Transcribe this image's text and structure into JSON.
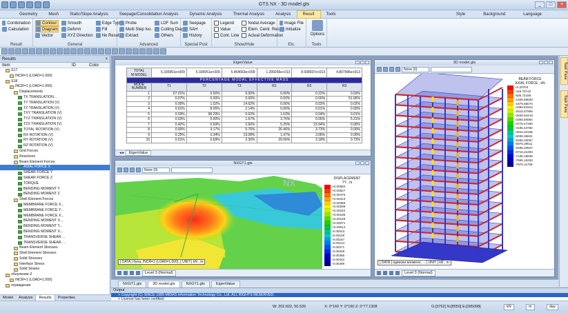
{
  "app": {
    "title": "GTS NX - 3D model.gts"
  },
  "window_controls": [
    "_",
    "□",
    "×"
  ],
  "menu": {
    "items": [
      "Geometry",
      "Mesh",
      "Static/Slope Analysis",
      "Seepage/Consolidation Analysis",
      "Dynamic Analysis",
      "Thermal Analysis",
      "Analysis",
      "Result",
      "Tools"
    ],
    "right": [
      "Style",
      "Background",
      "Language"
    ]
  },
  "ribbon": {
    "result": {
      "label": "Result",
      "items": [
        "Combination",
        "Calculation"
      ]
    },
    "general": {
      "label": "General",
      "col1": [
        "Contour",
        "Diagram",
        "Vector"
      ],
      "col2": [
        "Smooth",
        "Deform",
        "XYZ Direction"
      ],
      "col3": [
        "Edge Type",
        "Fill",
        "No Results"
      ]
    },
    "advanced": {
      "label": "Advanced",
      "col1": [
        "Probe",
        "Multi Step Iso.",
        "Extract"
      ],
      "col2": [
        "LDF Sum",
        "Cutting Diag.",
        "Others"
      ]
    },
    "special_post": {
      "label": "Special Post",
      "items": [
        "Seepage",
        "SAH",
        "History"
      ]
    },
    "show_hide": {
      "label": "Show/Hide",
      "col1": [
        "Legend",
        "Value",
        "Cont. Line"
      ],
      "col2": [
        "Nodal Average",
        "Elem. Centr. Result",
        "Actual Deformation"
      ]
    },
    "etc": {
      "label": "Etc.",
      "items": [
        "Image File",
        "Initialize"
      ]
    },
    "tools": {
      "label": "Tools",
      "items": [
        "Options"
      ]
    }
  },
  "results_panel": {
    "title": "Results",
    "columns": [
      "Item",
      "ID",
      "Color"
    ],
    "tree": [
      {
        "t": "S17",
        "lvl": 1,
        "icon": "y"
      },
      {
        "t": "INCR=1 (LOAD=1.000)",
        "lvl": 2,
        "icon": "y"
      },
      {
        "t": "S18",
        "lvl": 1,
        "icon": "y"
      },
      {
        "t": "INCR=1 (LOAD=1.000)",
        "lvl": 2,
        "icon": "y"
      },
      {
        "t": "Displacements",
        "lvl": 3,
        "icon": "y"
      },
      {
        "t": "TX TRANSLATION...",
        "lvl": 4,
        "icon": "g"
      },
      {
        "t": "TY TRANSLATION (V)",
        "lvl": 4,
        "icon": "g"
      },
      {
        "t": "TZ TRANSLATION (V)",
        "lvl": 4,
        "icon": "g"
      },
      {
        "t": "TXY TRANSLATION (V)",
        "lvl": 4,
        "icon": "g"
      },
      {
        "t": "TYZ TRANSLATION (V)",
        "lvl": 4,
        "icon": "g"
      },
      {
        "t": "TZX TRANSLATION (V)",
        "lvl": 4,
        "icon": "g"
      },
      {
        "t": "TOTAL ROTATION (V)",
        "lvl": 4,
        "icon": "g"
      },
      {
        "t": "RX ROTATION (V)",
        "lvl": 4,
        "icon": "g"
      },
      {
        "t": "RY ROTATION (V)",
        "lvl": 4,
        "icon": "g"
      },
      {
        "t": "RZ ROTATION (V)",
        "lvl": 4,
        "icon": "g"
      },
      {
        "t": "Grid Forces",
        "lvl": 3,
        "icon": "y"
      },
      {
        "t": "Reactions",
        "lvl": 3,
        "icon": "y"
      },
      {
        "t": "Beam Element Forces",
        "lvl": 3,
        "icon": "y"
      },
      {
        "t": "AXIAL FORCE X",
        "lvl": 4,
        "icon": "g",
        "hl": true
      },
      {
        "t": "SHEAR FORCE Y",
        "lvl": 4,
        "icon": "g"
      },
      {
        "t": "SHEAR FORCE Z",
        "lvl": 4,
        "icon": "g"
      },
      {
        "t": "TORQUE",
        "lvl": 4,
        "icon": "g"
      },
      {
        "t": "BENDING MOMENT Y",
        "lvl": 4,
        "icon": "g"
      },
      {
        "t": "BENDING MOMENT Z",
        "lvl": 4,
        "icon": "g"
      },
      {
        "t": "Shell Element Forces",
        "lvl": 3,
        "icon": "y"
      },
      {
        "t": "MEMBRANE FORCE X...",
        "lvl": 4,
        "icon": "g"
      },
      {
        "t": "MEMBRANE FORCE Y...",
        "lvl": 4,
        "icon": "g"
      },
      {
        "t": "MEMBRANE FORCE X...",
        "lvl": 4,
        "icon": "g"
      },
      {
        "t": "BENDING MOMENT X...",
        "lvl": 4,
        "icon": "g"
      },
      {
        "t": "BENDING MOMENT Y...",
        "lvl": 4,
        "icon": "g"
      },
      {
        "t": "BENDING MOMENT X...",
        "lvl": 4,
        "icon": "g"
      },
      {
        "t": "TRANSVERSE SHEAR ...",
        "lvl": 4,
        "icon": "g"
      },
      {
        "t": "TRANSVERSE SHEAR ...",
        "lvl": 4,
        "icon": "g"
      },
      {
        "t": "Beam Element Stresses",
        "lvl": 3,
        "icon": "y"
      },
      {
        "t": "Shell Element Stresses",
        "lvl": 3,
        "icon": "y"
      },
      {
        "t": "Solid Stresses",
        "lvl": 3,
        "icon": "y"
      },
      {
        "t": "Interface Stress",
        "lvl": 3,
        "icon": "y"
      },
      {
        "t": "Solid Strains",
        "lvl": 3,
        "icon": "y"
      },
      {
        "t": "обнуление-2",
        "lvl": 1,
        "icon": "y"
      },
      {
        "t": "INCR=1 (LOAD=1.000)",
        "lvl": 2,
        "icon": "y"
      },
      {
        "t": "ограждение",
        "lvl": 1,
        "icon": "y"
      }
    ],
    "tabs": [
      "Model",
      "Analysis",
      "Results",
      "Properties"
    ]
  },
  "eigen_window": {
    "title": "EigenValue",
    "total_row": {
      "label": "TOTAL\nM MODEL",
      "values": [
        "5.335951e+009",
        "5.335951e+009",
        "5.464663e+009",
        "1.299266e+013",
        "8.938937e+013",
        "4.807996e+013"
      ]
    },
    "band": "PERCENTAGE MODAL EFFECTIVE MASS",
    "headers": [
      "MODE\nNUMBER",
      "T1",
      "T2",
      "T3",
      "R1",
      "R2",
      "R3"
    ],
    "rows": [
      [
        "1",
        "67.01%",
        "0.00%",
        "0.00%",
        "0.00%",
        "0.22%",
        "0.03%"
      ],
      [
        "2",
        "0.07%",
        "0.00%",
        "0.00%",
        "0.00%",
        "0.00%",
        "51.96%"
      ],
      [
        "3",
        "0.00%",
        "1.02%",
        "14.62%",
        "0.06%",
        "0.02%",
        "0.02%"
      ],
      [
        "4",
        "0.01%",
        "8.05%",
        "2.14%",
        "0.00%",
        "0.01%",
        "0.00%"
      ],
      [
        "5",
        "0.03%",
        "96.29%",
        "0.62%",
        "1.63%",
        "0.04%",
        "0.01%"
      ],
      [
        "6",
        "0.03%",
        "0.00%",
        "1.67%",
        "3.76%",
        "0.05%",
        "5.31%"
      ],
      [
        "7",
        "0.42%",
        "0.69%",
        "2.60%",
        "5.25%",
        "23.94%",
        "0.00%"
      ],
      [
        "8",
        "0.00%",
        "3.17%",
        "5.76%",
        "26.46%",
        "3.73%",
        "0.00%"
      ],
      [
        "9",
        "0.25%",
        "0.34%",
        "19.08%",
        "1.97%",
        "3.06%",
        "0.00%"
      ],
      [
        "10",
        "0.01%",
        "0.69%",
        "2.30%",
        "29.06%",
        "3.18%",
        "0.73%"
      ]
    ],
    "tab": "EigenValue"
  },
  "nxgt_window": {
    "title": "NXGT1.gts",
    "dropdown": "None (0)",
    "legend_title": "DISPLACEMENT\nTY , m",
    "legend": [
      "+0.00584",
      "+0.00527",
      "+0.00470",
      "+0.00413",
      "+0.00356",
      "+0.00299",
      "+0.00242",
      "+0.00185",
      "+0.00128",
      "+0.00071",
      "+0.00014",
      "-0.00043",
      "-0.00100",
      "-0.00157",
      "-0.00214",
      "-0.00271",
      "-0.00328",
      "-0.00385",
      "-0.00442",
      "-0.00499"
    ],
    "info": "[ DATA ] буна, INCR=1 (LOAD=1.000), [ UNIT ] kN , m",
    "level": "Level 3 (Normal)"
  },
  "model3d_window": {
    "title": "3D model.gts",
    "dropdown": "None (0)",
    "legend_title": "BEAM FORCE\nAXIAL FORCE , kN",
    "legend": [
      "+4.20702",
      "-415.75742",
      "-835.72186",
      "-1255.68630",
      "-1675.65074",
      "-2095.61523",
      "-2515.57969",
      "-2935.54419",
      "-3355.50864",
      "-3775.47290",
      "-4195.43750",
      "-4615.40195",
      "-5035.36621",
      "-5455.33057",
      "-5875.29511",
      "-6295.25947",
      "-6715.22393",
      "-7135.18848",
      "-7555.15293",
      "-7975.11759"
    ],
    "info": "[ DATA ] одиноки вложено, ... [ UNIT ] kN , m",
    "level": "Level 3 (Normal)"
  },
  "document_tabs": [
    "NXGT1.gts",
    "3D model.gts",
    "NXGT1.gts",
    "EigenValue"
  ],
  "right_strip": [
    "Task Pane",
    "Task Pane"
  ],
  "output": {
    "title": "Output",
    "lines": [
      "> Copyright (C) SINCE 1989 MIDAS Information Technology Co., Ltd. ALL RIGHTS RESERVED.",
      "> License has been certified."
    ]
  },
  "status": {
    "coords": "W: 202.602, 50.539",
    "angle": "X: 0°160 Y: 0°160 Z: 0°77.1308",
    "node": "G:[3762] N:[8550] E:[285098]",
    "unit_force": "kN",
    "unit_len": "m",
    "unit_time": "day"
  },
  "colors": {
    "accent": "#3d7bd4",
    "band": "#2a2aa0",
    "ribbon_selected": "#fbe09a",
    "frame_red": "#d1282c",
    "frame_blue": "#3338c9"
  }
}
